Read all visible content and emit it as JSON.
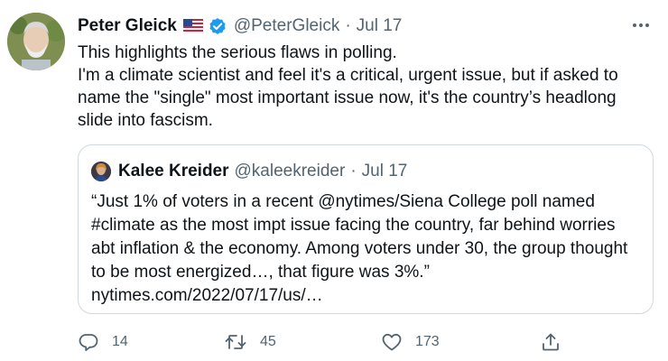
{
  "tweet": {
    "author_name": "Peter Gleick",
    "handle": "@PeterGleick",
    "separator": "·",
    "date": "Jul 17",
    "text_lines": [
      "This highlights the serious flaws in polling.",
      "I'm a climate scientist and feel it's a critical, urgent issue, but if asked to",
      "name the \"single\" most important issue now, it's the country’s headlong",
      "slide into fascism."
    ]
  },
  "quoted": {
    "author_name": "Kalee Kreider",
    "handle": "@kaleekreider",
    "separator": "·",
    "date": "Jul 17",
    "text_lines": [
      "“Just 1% of voters in a recent @nytimes/Siena College poll named",
      "#climate as the most impt issue facing the country, far behind worries",
      "abt inflation & the economy. Among voters under 30, the group thought",
      "to be most energized…, that figure was 3%.”",
      "nytimes.com/2022/07/17/us/…"
    ]
  },
  "actions": {
    "reply_count": "14",
    "retweet_count": "45",
    "like_count": "173"
  },
  "icons": {
    "flag": "us-flag-icon",
    "verified": "verified-badge-icon",
    "more": "more-options-icon",
    "reply": "reply-icon",
    "retweet": "retweet-icon",
    "like": "heart-icon",
    "share": "share-icon"
  },
  "colors": {
    "text": "#0f1419",
    "secondary": "#536471",
    "verified_blue": "#1d9bf0",
    "border": "#cfd9de"
  }
}
